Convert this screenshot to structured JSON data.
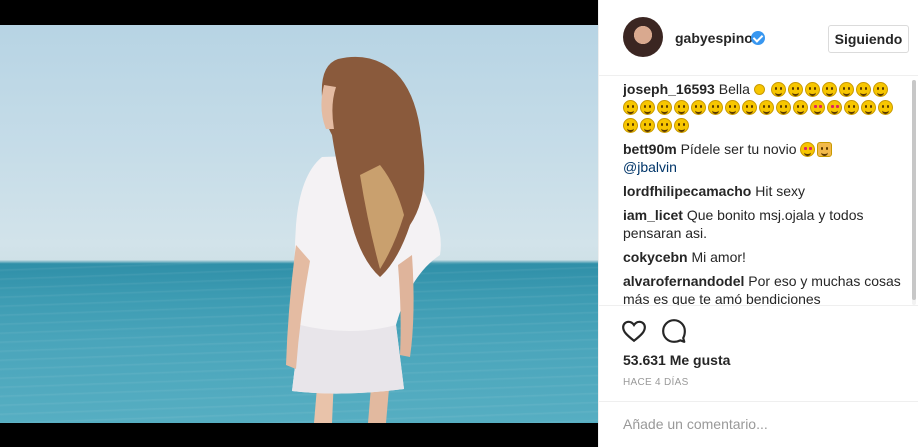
{
  "post": {
    "username": "gabyespino",
    "follow_label": "Siguiendo",
    "likes_text": "53.631 Me gusta",
    "time_text": "HACE 4 DÍAS",
    "add_comment_placeholder": "Añade un comentario..."
  },
  "comments": [
    {
      "user": "joseph_16593",
      "text": "Bella"
    },
    {
      "user": "bett90m",
      "text": "Pídele ser tu novio",
      "mention": "@jbalvin"
    },
    {
      "user": "lordfhilipecamacho",
      "text": "Hit sexy"
    },
    {
      "user": "iam_licet",
      "text": "Que bonito msj.ojala y todos pensaran asi."
    },
    {
      "user": "cokycebn",
      "text": "Mi amor!"
    },
    {
      "user": "alvarofernandodel",
      "text": "Por eso y muchas cosas más es que te amó bendiciones"
    }
  ],
  "icons": {
    "like": "heart-outline-icon",
    "comment": "speech-bubble-icon",
    "verified": "verified-badge-icon"
  },
  "colors": {
    "verified_blue": "#3897f0",
    "text": "#262626",
    "muted": "#999999",
    "mention": "#003569"
  }
}
